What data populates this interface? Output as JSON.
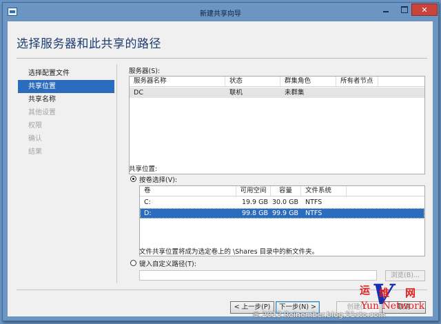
{
  "window": {
    "title": "新建共享向导"
  },
  "header": {
    "title": "选择服务器和此共享的路径"
  },
  "nav": {
    "items": [
      {
        "label": "选择配置文件",
        "state": "normal"
      },
      {
        "label": "共享位置",
        "state": "active"
      },
      {
        "label": "共享名称",
        "state": "normal"
      },
      {
        "label": "其他设置",
        "state": "disabled"
      },
      {
        "label": "权限",
        "state": "disabled"
      },
      {
        "label": "确认",
        "state": "disabled"
      },
      {
        "label": "结果",
        "state": "disabled"
      }
    ]
  },
  "servers": {
    "label": "服务器(S):",
    "columns": [
      "服务器名称",
      "状态",
      "群集角色",
      "所有者节点"
    ],
    "rows": [
      {
        "name": "DC",
        "status": "联机",
        "role": "未群集",
        "owner": ""
      }
    ]
  },
  "share_location": {
    "label": "共享位置:",
    "by_volume_label": "按卷选择(V):",
    "by_volume_selected": true,
    "volume_columns": [
      "卷",
      "可用空间",
      "容量",
      "文件系统"
    ],
    "volumes": [
      {
        "volume": "C:",
        "free": "19.9 GB",
        "capacity": "30.0 GB",
        "fs": "NTFS",
        "selected": false
      },
      {
        "volume": "D:",
        "free": "99.8 GB",
        "capacity": "99.9 GB",
        "fs": "NTFS",
        "selected": true
      }
    ],
    "note": "文件共享位置将成为选定卷上的 \\Shares 目录中的新文件夹。",
    "custom_path_label": "键入自定义路径(T):",
    "custom_path_value": "",
    "browse_label": "浏览(B)..."
  },
  "footer": {
    "prev_label": "< 上一步(P)",
    "next_label": "下一步(N) >",
    "create_label": "创建(C)",
    "cancel_label": "取消"
  },
  "watermark": {
    "yun": "运",
    "wei": "维",
    "wang": "网",
    "v": "V",
    "en": "Yun  Network"
  },
  "copyright": "© 2013 Reinember.blog.51cto.com"
}
